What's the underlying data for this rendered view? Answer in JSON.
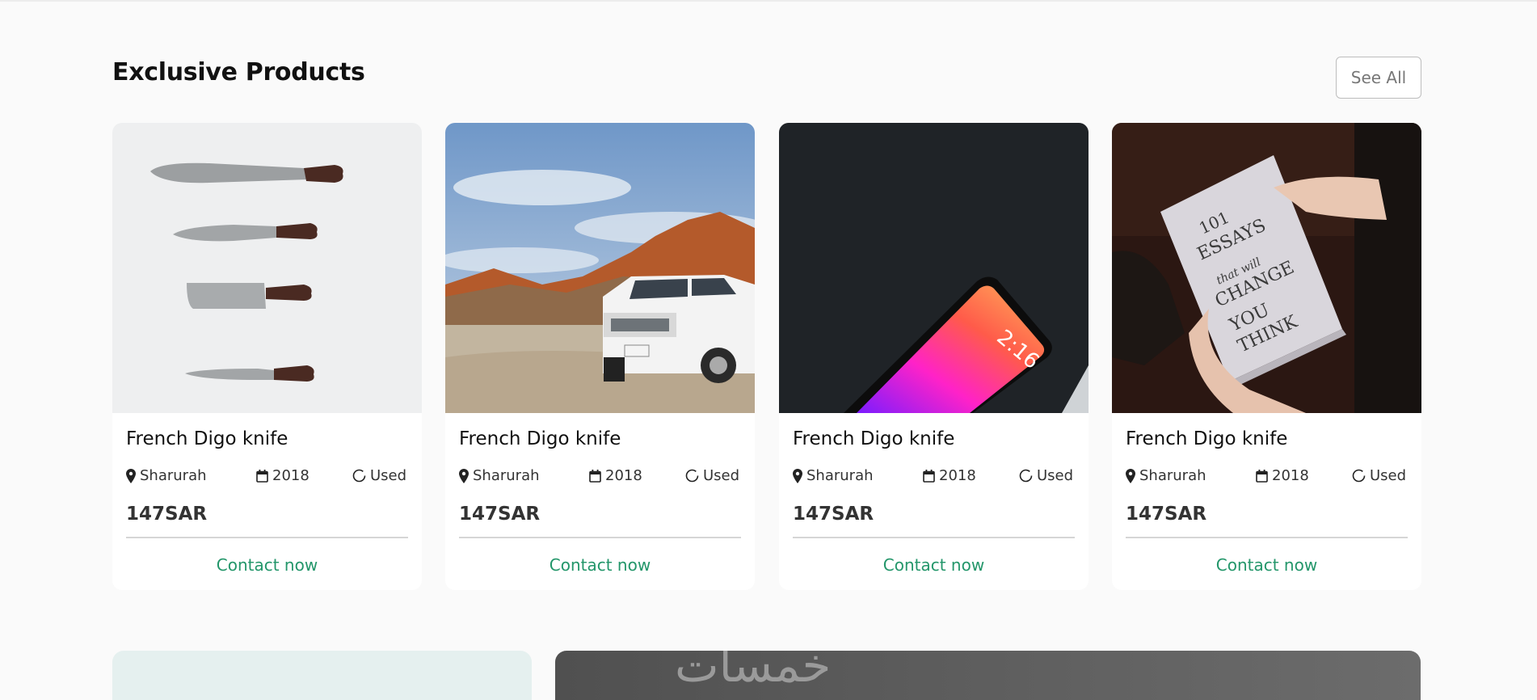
{
  "section": {
    "title": "Exclusive Products",
    "see_all_label": "See All"
  },
  "products": [
    {
      "name": "French Digo knife",
      "location": "Sharurah",
      "year": "2018",
      "condition": "Used",
      "price": "147SAR",
      "contact_label": "Contact now",
      "image": "knives-set"
    },
    {
      "name": "French Digo knife",
      "location": "Sharurah",
      "year": "2018",
      "condition": "Used",
      "price": "147SAR",
      "contact_label": "Contact now",
      "image": "white-suv-desert"
    },
    {
      "name": "French Digo knife",
      "location": "Sharurah",
      "year": "2018",
      "condition": "Used",
      "price": "147SAR",
      "contact_label": "Contact now",
      "image": "smartphone-on-black"
    },
    {
      "name": "French Digo knife",
      "location": "Sharurah",
      "year": "2018",
      "condition": "Used",
      "price": "147SAR",
      "contact_label": "Contact now",
      "image": "book-101-essays"
    }
  ],
  "banner": {
    "watermark": "خمسات"
  },
  "colors": {
    "accent_green": "#23966a",
    "background": "#fafafa",
    "banner_left_bg": "#e5f0ef",
    "banner_right_bg": "#5a5a5a"
  }
}
